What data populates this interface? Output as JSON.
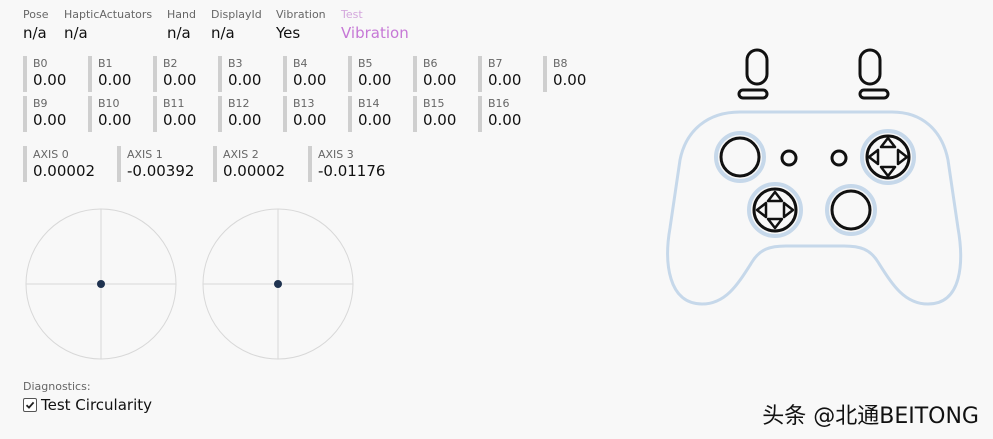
{
  "header": {
    "pose": {
      "label": "Pose",
      "value": "n/a"
    },
    "haptic": {
      "label": "HapticActuators",
      "value": "n/a"
    },
    "hand": {
      "label": "Hand",
      "value": "n/a"
    },
    "display": {
      "label": "DisplayId",
      "value": "n/a"
    },
    "vibration": {
      "label": "Vibration",
      "value": "Yes"
    },
    "test": {
      "label": "Test",
      "value": "Vibration"
    }
  },
  "buttons": [
    {
      "label": "B0",
      "value": "0.00"
    },
    {
      "label": "B1",
      "value": "0.00"
    },
    {
      "label": "B2",
      "value": "0.00"
    },
    {
      "label": "B3",
      "value": "0.00"
    },
    {
      "label": "B4",
      "value": "0.00"
    },
    {
      "label": "B5",
      "value": "0.00"
    },
    {
      "label": "B6",
      "value": "0.00"
    },
    {
      "label": "B7",
      "value": "0.00"
    },
    {
      "label": "B8",
      "value": "0.00"
    },
    {
      "label": "B9",
      "value": "0.00"
    },
    {
      "label": "B10",
      "value": "0.00"
    },
    {
      "label": "B11",
      "value": "0.00"
    },
    {
      "label": "B12",
      "value": "0.00"
    },
    {
      "label": "B13",
      "value": "0.00"
    },
    {
      "label": "B14",
      "value": "0.00"
    },
    {
      "label": "B15",
      "value": "0.00"
    },
    {
      "label": "B16",
      "value": "0.00"
    }
  ],
  "axes": [
    {
      "label": "AXIS 0",
      "value": "0.00002"
    },
    {
      "label": "AXIS 1",
      "value": "-0.00392"
    },
    {
      "label": "AXIS 2",
      "value": "0.00002"
    },
    {
      "label": "AXIS 3",
      "value": "-0.01176"
    }
  ],
  "diagnostics": {
    "label": "Diagnostics:",
    "circularity": {
      "label": "Test Circularity",
      "checked": true
    }
  },
  "watermark": "头条 @北通BEITONG",
  "colors": {
    "accent_test": "#c678d6",
    "controller_outline": "#c6d8ea",
    "stick_dot": "#1f3350",
    "gauge_border": "#cfcfcf"
  }
}
